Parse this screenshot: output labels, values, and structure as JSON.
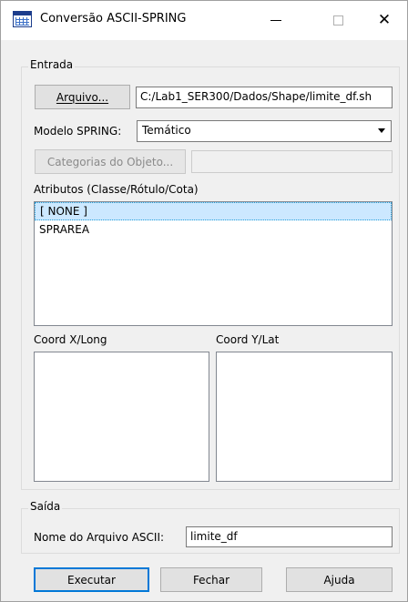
{
  "window": {
    "title": "Conversão ASCII-SPRING",
    "icon": "grid-map-icon",
    "controls": {
      "minimize": "minimize-icon",
      "maximize": "maximize-icon",
      "close": "close-icon"
    }
  },
  "entrada": {
    "group_label": "Entrada",
    "arquivo_button": "Arquivo...",
    "arquivo_path": "C:/Lab1_SER300/Dados/Shape/limite_df.sh",
    "modelo_label": "Modelo SPRING:",
    "modelo_value": "Temático",
    "categorias_button": "Categorias do Objeto...",
    "categorias_value": "",
    "atributos_label": "Atributos (Classe/Rótulo/Cota)",
    "atributos_items": [
      "[ NONE ]",
      "SPRAREA"
    ],
    "atributos_selected": 0,
    "coord_x_label": "Coord X/Long",
    "coord_y_label": "Coord Y/Lat"
  },
  "saida": {
    "group_label": "Saída",
    "nome_label": "Nome do Arquivo ASCII:",
    "nome_value": "limite_df"
  },
  "buttons": {
    "executar": "Executar",
    "fechar": "Fechar",
    "ajuda": "Ajuda"
  }
}
